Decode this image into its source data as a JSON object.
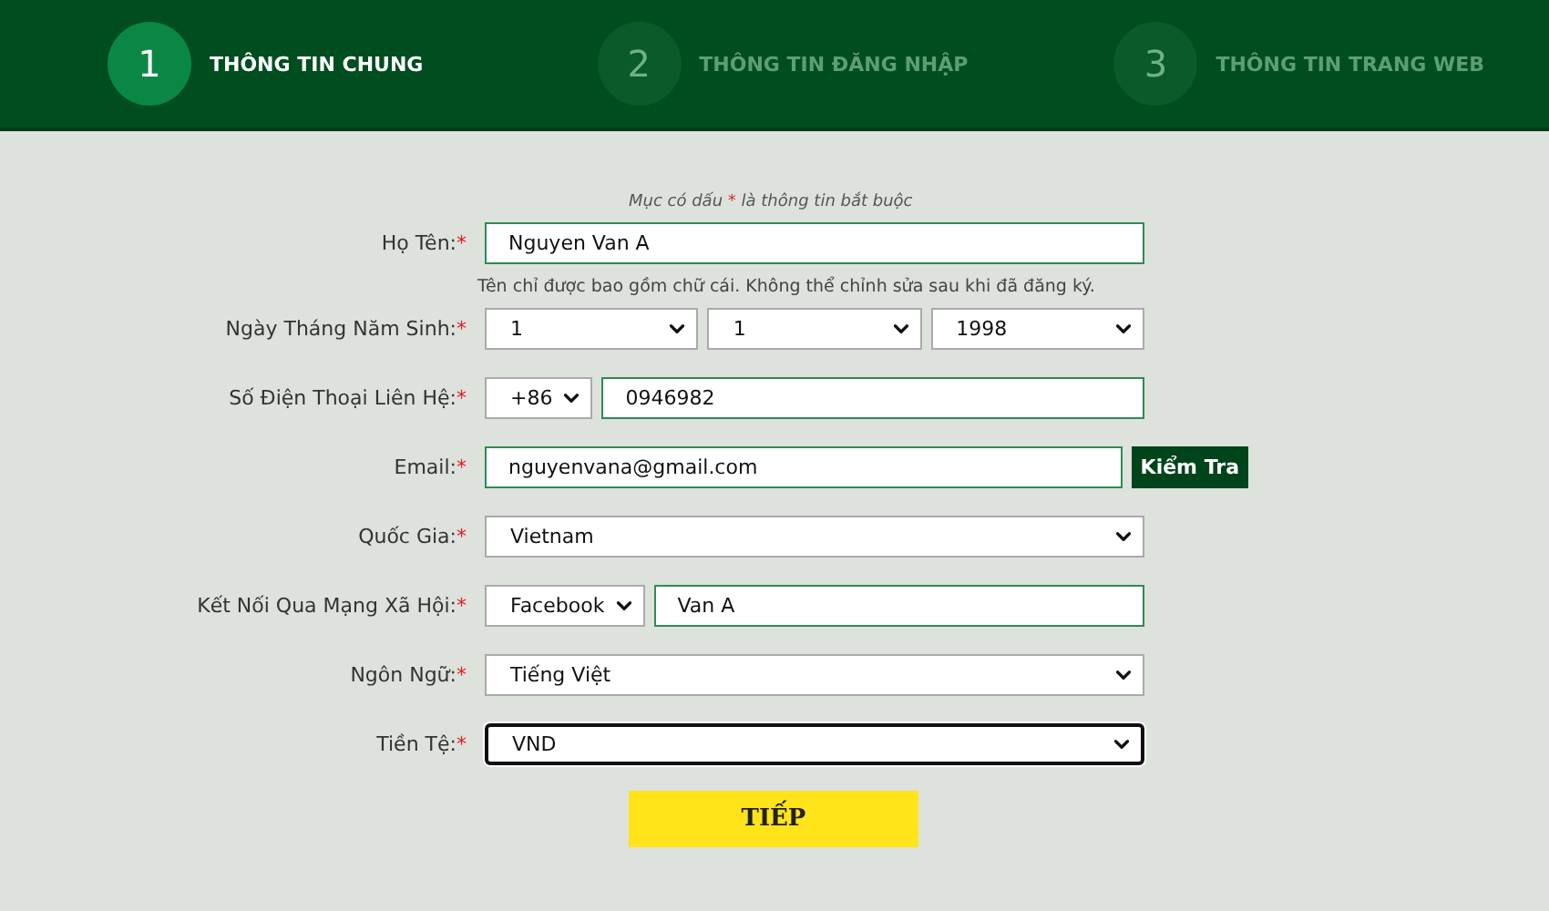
{
  "steps": [
    {
      "number": "1",
      "label": "THÔNG TIN CHUNG",
      "selected": true
    },
    {
      "number": "2",
      "label": "THÔNG TIN ĐĂNG NHẬP",
      "selected": false
    },
    {
      "number": "3",
      "label": "THÔNG TIN TRANG WEB",
      "selected": false
    }
  ],
  "note": {
    "before": "Mục có dấu",
    "mark": "*",
    "after": "là thông tin bắt buộc"
  },
  "fields": [
    {
      "label": "Họ Tên:",
      "required": "*",
      "controls": [
        {
          "kind": "input",
          "value": "Nguyen Van A",
          "focused": false
        }
      ],
      "hint": "Tên chỉ được bao gồm chữ cái. Không thể chỉnh sửa sau khi đã đăng ký."
    },
    {
      "label": "Ngày Tháng Năm Sinh:",
      "required": "*",
      "controls": [
        {
          "kind": "select",
          "value": "1",
          "focused": false
        },
        {
          "kind": "select",
          "value": "1",
          "focused": false
        },
        {
          "kind": "select",
          "value": "1998",
          "focused": false
        }
      ]
    },
    {
      "label": "Số Điện Thoại Liên Hệ:",
      "required": "*",
      "controls": [
        {
          "kind": "select",
          "value": "+86",
          "focused": false
        },
        {
          "kind": "input",
          "value": "0946982",
          "focused": false
        }
      ]
    },
    {
      "label": "Email:",
      "required": "*",
      "controls": [
        {
          "kind": "input",
          "value": "nguyenvana@gmail.com",
          "focused": false
        },
        {
          "kind": "button",
          "value": "Kiểm Tra"
        }
      ]
    },
    {
      "label": "Quốc Gia:",
      "required": "*",
      "controls": [
        {
          "kind": "select",
          "value": "Vietnam",
          "focused": false
        }
      ]
    },
    {
      "label": "Kết Nối Qua Mạng Xã Hội:",
      "required": "*",
      "controls": [
        {
          "kind": "select",
          "value": "Facebook",
          "focused": false
        },
        {
          "kind": "input",
          "value": "Van A",
          "focused": false
        }
      ]
    },
    {
      "label": "Ngôn Ngữ:",
      "required": "*",
      "controls": [
        {
          "kind": "select",
          "value": "Tiếng Việt",
          "focused": false
        }
      ]
    },
    {
      "label": "Tiền Tệ:",
      "required": "*",
      "controls": [
        {
          "kind": "select",
          "value": "VND",
          "focused": true
        }
      ]
    }
  ],
  "submit": "TIẾP"
}
